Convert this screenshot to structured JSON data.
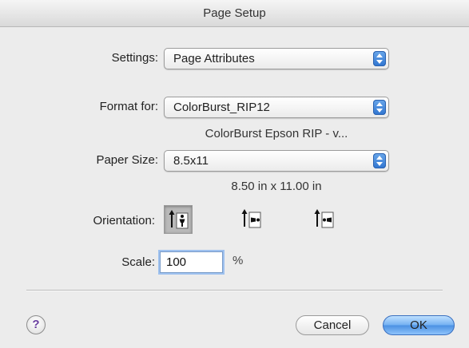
{
  "window": {
    "title": "Page Setup"
  },
  "settings": {
    "label": "Settings:",
    "value": "Page Attributes"
  },
  "format_for": {
    "label": "Format for:",
    "value": "ColorBurst_RIP12",
    "description": "ColorBurst Epson RIP - v..."
  },
  "paper_size": {
    "label": "Paper Size:",
    "value": "8.5x11",
    "dimensions": "8.50 in x 11.00 in"
  },
  "orientation": {
    "label": "Orientation:",
    "options": [
      {
        "name": "portrait",
        "icon": "portrait-icon",
        "selected": true
      },
      {
        "name": "landscape-left",
        "icon": "landscape-left-icon",
        "selected": false
      },
      {
        "name": "landscape-right",
        "icon": "landscape-right-icon",
        "selected": false
      }
    ]
  },
  "scale": {
    "label": "Scale:",
    "value": "100",
    "unit": "%"
  },
  "buttons": {
    "help": "?",
    "cancel": "Cancel",
    "ok": "OK"
  },
  "colors": {
    "accent": "#4a90e2",
    "help_glyph": "#6a3fa0"
  }
}
